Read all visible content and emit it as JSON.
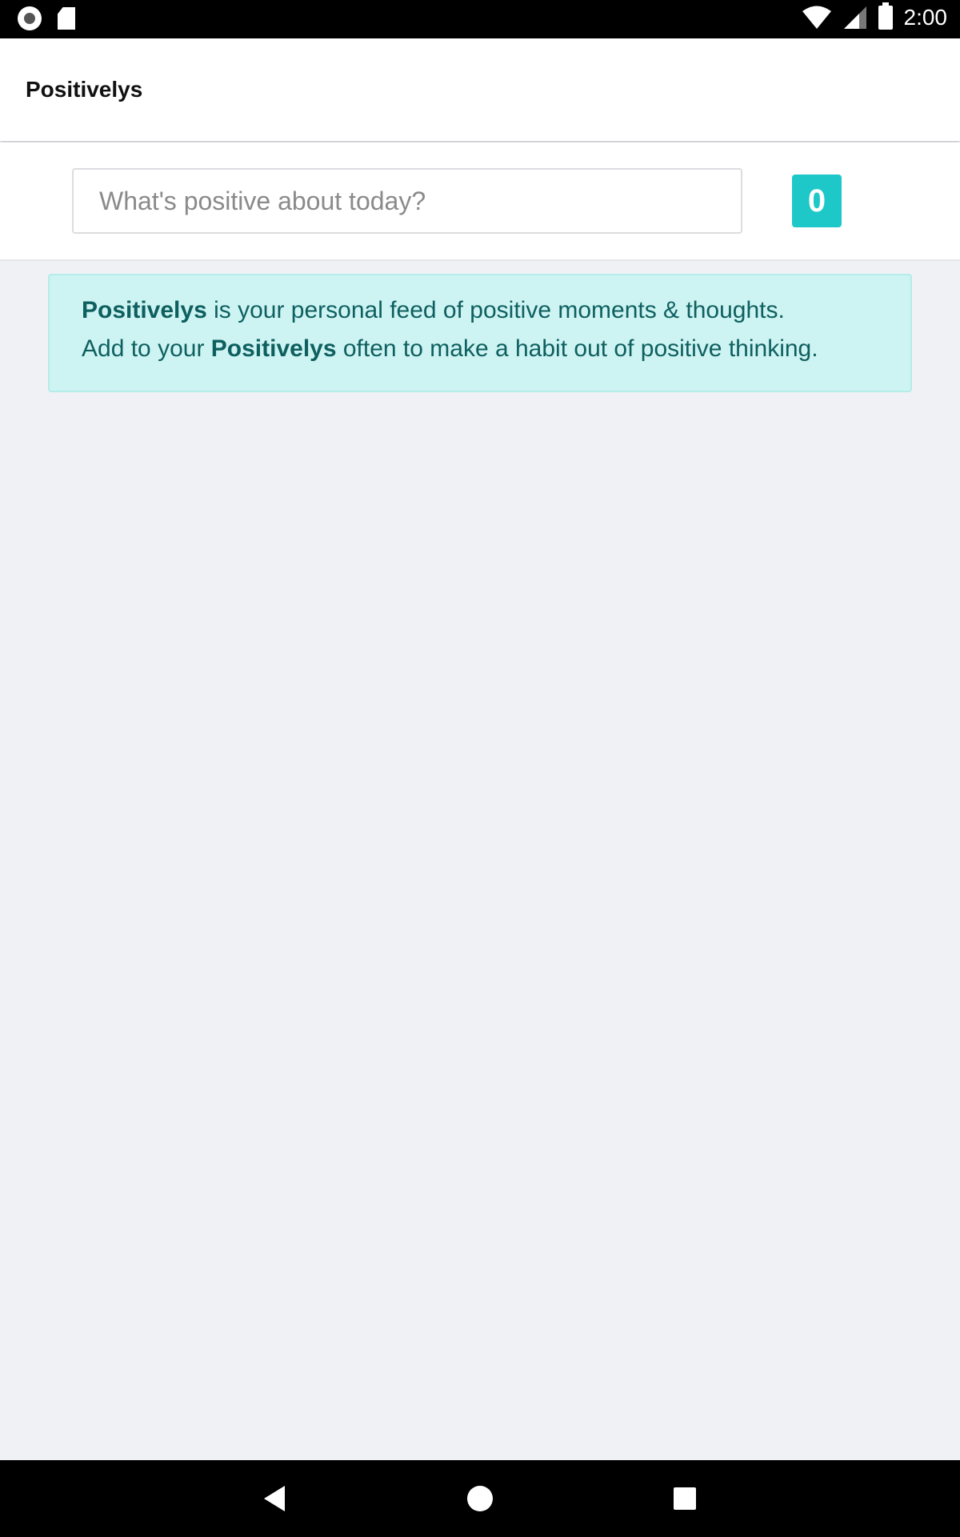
{
  "status_bar": {
    "time": "2:00",
    "icons": [
      "record-icon",
      "sd-card-icon",
      "wifi-icon",
      "signal-icon",
      "battery-icon"
    ]
  },
  "header": {
    "title": "Positivelys"
  },
  "composer": {
    "placeholder": "What's positive about today?",
    "value": "",
    "count": "0"
  },
  "info": {
    "brand": "Positivelys",
    "line1_rest": " is your personal feed of positive moments & thoughts.",
    "line2_start": "Add to your ",
    "line2_end": " often to make a habit out of positive thinking."
  },
  "colors": {
    "accent": "#1ec8c8",
    "info_bg": "#cdf4f3",
    "info_text": "#0e5f5f",
    "page_bg": "#eff1f5"
  },
  "nav_bar": {
    "icons": [
      "back-icon",
      "home-icon",
      "recent-apps-icon"
    ]
  }
}
